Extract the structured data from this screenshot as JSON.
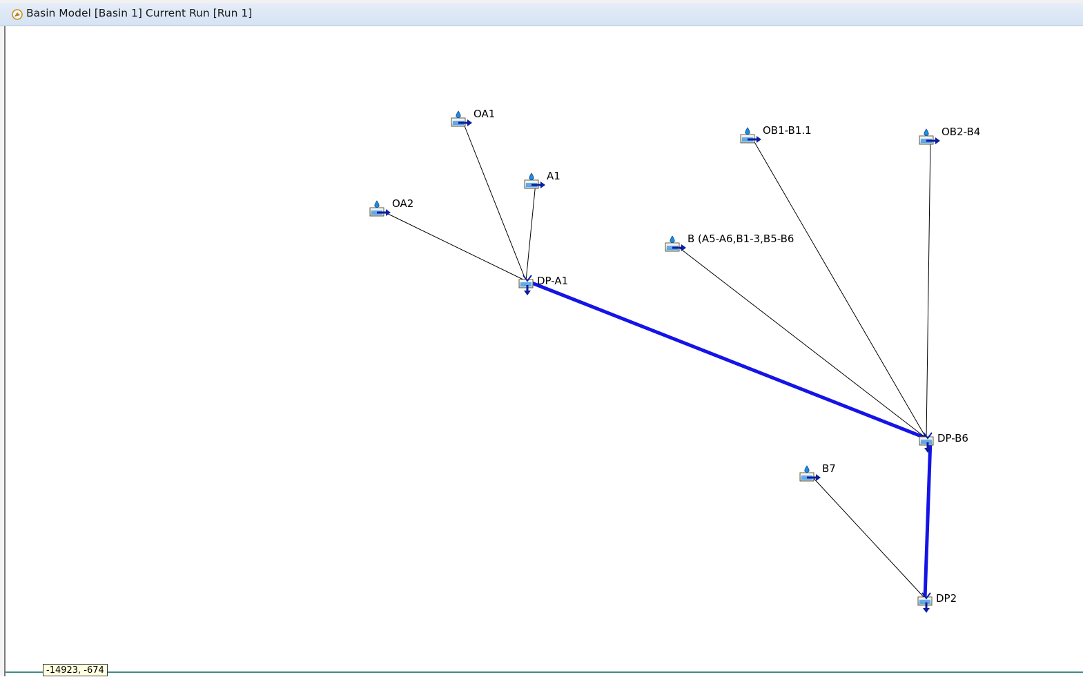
{
  "window": {
    "title": "Basin Model [Basin 1] Current Run [Run 1]",
    "title_icon": "basin-model-icon"
  },
  "nodes": [
    {
      "id": "OA1",
      "label": "OA1",
      "kind": "subbasin"
    },
    {
      "id": "A1",
      "label": "A1",
      "kind": "subbasin"
    },
    {
      "id": "OA2",
      "label": "OA2",
      "kind": "subbasin"
    },
    {
      "id": "DP-A1",
      "label": "DP-A1",
      "kind": "junction"
    },
    {
      "id": "OB1-B1.1",
      "label": "OB1-B1.1",
      "kind": "subbasin"
    },
    {
      "id": "OB2-B4",
      "label": "OB2-B4",
      "kind": "subbasin"
    },
    {
      "id": "B",
      "label": "B (A5-A6,B1-3,B5-B6",
      "kind": "subbasin"
    },
    {
      "id": "DP-B6",
      "label": "DP-B6",
      "kind": "junction"
    },
    {
      "id": "B7",
      "label": "B7",
      "kind": "subbasin"
    },
    {
      "id": "DP2",
      "label": "DP2",
      "kind": "junction"
    }
  ],
  "connections": [
    {
      "from": "OA1",
      "to": "DP-A1",
      "type": "thin"
    },
    {
      "from": "A1",
      "to": "DP-A1",
      "type": "thin"
    },
    {
      "from": "OA2",
      "to": "DP-A1",
      "type": "thin"
    },
    {
      "from": "DP-A1",
      "to": "DP-B6",
      "type": "reach"
    },
    {
      "from": "B",
      "to": "DP-B6",
      "type": "thin"
    },
    {
      "from": "OB1-B1.1",
      "to": "DP-B6",
      "type": "thin"
    },
    {
      "from": "OB2-B4",
      "to": "DP-B6",
      "type": "thin"
    },
    {
      "from": "DP-B6",
      "to": "DP2",
      "type": "reach"
    },
    {
      "from": "B7",
      "to": "DP2",
      "type": "thin"
    }
  ],
  "status": {
    "coordinates": "-14923, -674"
  },
  "colors": {
    "reach": "#1414e6",
    "thin_line": "#000000",
    "icon_blue": "#2a7fd4",
    "arrow": "#0a1ea0"
  }
}
